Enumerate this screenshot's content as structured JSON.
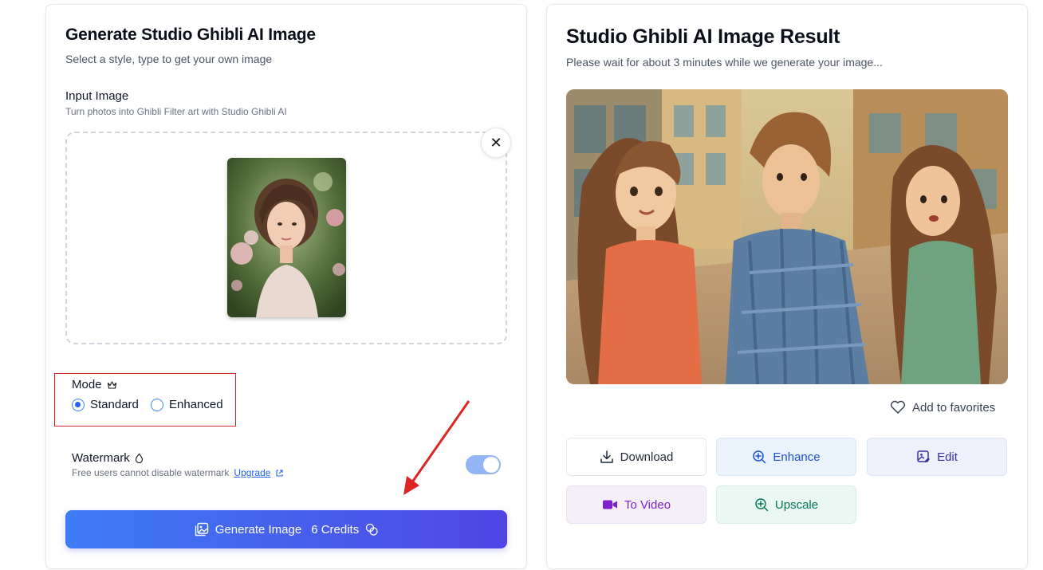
{
  "left": {
    "title": "Generate Studio Ghibli AI Image",
    "subtitle": "Select a style, type to get your own image",
    "input_label": "Input Image",
    "input_hint": "Turn photos into Ghibli Filter art with Studio Ghibli AI",
    "mode": {
      "label": "Mode",
      "options": [
        "Standard",
        "Enhanced"
      ],
      "selected": "Standard"
    },
    "watermark": {
      "label": "Watermark",
      "hint": "Free users cannot disable watermark",
      "link": "Upgrade",
      "enabled": true
    },
    "generate_button": {
      "label": "Generate Image",
      "credits": "6 Credits"
    }
  },
  "right": {
    "title": "Studio Ghibli AI Image Result",
    "subtitle": "Please wait for about 3 minutes while we generate your image...",
    "favorite_label": "Add to favorites",
    "actions": {
      "download": "Download",
      "enhance": "Enhance",
      "edit": "Edit",
      "to_video": "To Video",
      "upscale": "Upscale"
    }
  },
  "colors": {
    "accent": "#3b82f6",
    "gradient_end": "#4f46e5",
    "highlight_box": "#dc2626",
    "annotation_arrow": "#dc2626"
  },
  "icons": [
    "close-icon",
    "crown-icon",
    "drop-icon",
    "external-link-icon",
    "image-icon",
    "coins-icon",
    "heart-icon",
    "download-icon",
    "zoom-in-icon",
    "image-edit-icon",
    "video-icon",
    "plus-zoom-icon"
  ]
}
